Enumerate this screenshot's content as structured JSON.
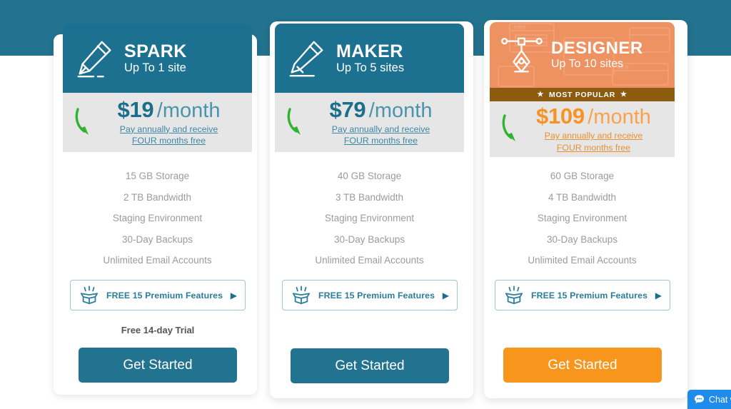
{
  "page": {
    "band_color": "#22738f",
    "background": "#ffffff"
  },
  "plans": [
    {
      "id": "spark",
      "name": "SPARK",
      "sites": "Up To 1 site",
      "icon": "pencil-icon",
      "header_color": "#1c7191",
      "price_amount": "$19",
      "price_period": "/month",
      "annual_line1": "Pay annually and receive",
      "annual_line2": "FOUR months free ",
      "features": [
        "15 GB Storage",
        "2 TB Bandwidth",
        "Staging Environment",
        "30-Day Backups",
        "Unlimited Email Accounts"
      ],
      "premium_label": "FREE 15 Premium Features",
      "trial_note": "Free 14-day Trial",
      "cta_label": "Get Started",
      "cta_color": "#22738f",
      "badge": null
    },
    {
      "id": "maker",
      "name": "MAKER",
      "sites": "Up To 5 sites",
      "icon": "pen-icon",
      "header_color": "#1c7191",
      "price_amount": "$79",
      "price_period": "/month",
      "annual_line1": "Pay annually and receive",
      "annual_line2": "FOUR months free",
      "features": [
        "40 GB Storage",
        "3 TB Bandwidth",
        "Staging Environment",
        "30-Day Backups",
        "Unlimited Email Accounts"
      ],
      "premium_label": "FREE 15 Premium Features",
      "trial_note": null,
      "cta_label": "Get Started",
      "cta_color": "#22738f",
      "badge": null
    },
    {
      "id": "designer",
      "name": "DESIGNER",
      "sites": "Up To 10 sites",
      "icon": "pen-tool-icon",
      "header_color": "#ef9262",
      "price_amount": "$109",
      "price_period": "/month",
      "annual_line1": "Pay annually and receive",
      "annual_line2": "FOUR months free",
      "features": [
        "60 GB Storage",
        "4 TB Bandwidth",
        "Staging Environment",
        "30-Day Backups",
        "Unlimited Email Accounts"
      ],
      "premium_label": "FREE 15 Premium Features",
      "trial_note": null,
      "cta_label": "Get Started",
      "cta_color": "#f8951d",
      "badge": {
        "label": "MOST POPULAR",
        "star": "★",
        "color": "#8c5b10"
      }
    }
  ],
  "chat_widget": {
    "label": "Chat wi",
    "icon": "chat-bubble-icon",
    "color": "#1f8ceb"
  }
}
